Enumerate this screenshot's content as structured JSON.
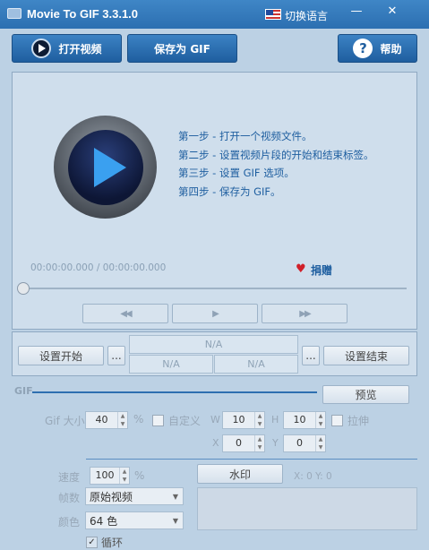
{
  "window": {
    "title": "Movie To GIF 3.3.1.0",
    "language_label": "切换语言",
    "minimize_glyph": "—",
    "close_glyph": "✕"
  },
  "toolbar": {
    "open_video": "打开视频",
    "save_gif": "保存为 GIF",
    "help": "帮助",
    "help_glyph": "?"
  },
  "preview": {
    "steps": [
      "第一步 - 打开一个视频文件。",
      "第二步 - 设置视频片段的开始和结束标签。",
      "第三步 - 设置 GIF 选项。",
      "第四步 - 保存为 GIF。"
    ],
    "time": "00:00:00.000 / 00:00:00.000",
    "donate": "捐赠",
    "heart_glyph": "♥",
    "rewind_glyph": "◀◀",
    "play_glyph": "▶",
    "forward_glyph": "▶▶"
  },
  "range": {
    "set_start": "设置开始",
    "set_end": "设置结束",
    "ellipsis": "...",
    "na_top": "N/A",
    "na_left": "N/A",
    "na_right": "N/A"
  },
  "gif": {
    "section_title": "GIF",
    "preview_button": "预览",
    "size_label": "Gif 大小",
    "size_value": "40",
    "percent": "%",
    "custom_label": "自定义",
    "w_label": "W",
    "w_value": "10",
    "h_label": "H",
    "h_value": "10",
    "stretch_label": "拉伸",
    "x_label": "X",
    "x_value": "0",
    "y_label": "Y",
    "y_value": "0",
    "speed_label": "速度",
    "speed_value": "100",
    "speed_percent": "%",
    "watermark_button": "水印",
    "coords": "X: 0  Y: 0",
    "frames_label": "帧数",
    "frames_value": "原始视频",
    "color_label": "颜色",
    "color_value": "64 色",
    "loop_label": "循环",
    "loop_checked": true
  }
}
